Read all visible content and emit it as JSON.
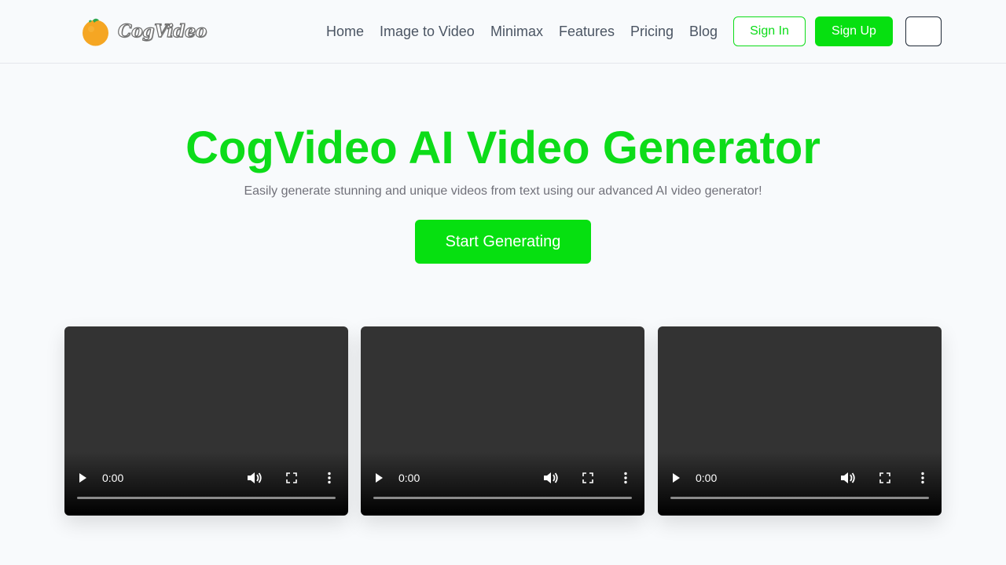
{
  "brand": {
    "name": "CogVideo",
    "logo_icon": "orange-fruit-icon",
    "colors": {
      "accent": "#06e010",
      "heading": "#0ddc19",
      "orange": "#f5a623"
    }
  },
  "nav": {
    "items": [
      {
        "label": "Home"
      },
      {
        "label": "Image to Video"
      },
      {
        "label": "Minimax"
      },
      {
        "label": "Features"
      },
      {
        "label": "Pricing"
      },
      {
        "label": "Blog"
      }
    ],
    "sign_in": "Sign In",
    "sign_up": "Sign Up",
    "theme_toggle_icon": "theme-toggle-icon"
  },
  "hero": {
    "title": "CogVideo AI Video Generator",
    "subtitle": "Easily generate stunning and unique videos from text using our advanced AI video generator!",
    "cta": "Start Generating"
  },
  "videos": [
    {
      "time": "0:00",
      "progress": 0
    },
    {
      "time": "0:00",
      "progress": 0
    },
    {
      "time": "0:00",
      "progress": 0
    }
  ]
}
